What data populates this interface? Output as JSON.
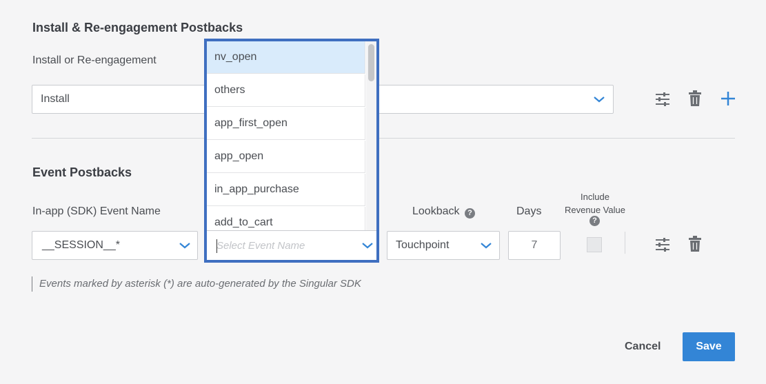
{
  "install_section": {
    "title": "Install & Re-engagement Postbacks",
    "field_label": "Install or Re-engagement",
    "selected_value": "Install"
  },
  "event_section": {
    "title": "Event Postbacks",
    "event_name_label": "In-app (SDK) Event Name",
    "event_name_value": "__SESSION__*",
    "lookback_label": "Lookback",
    "lookback_value": "Touchpoint",
    "days_label": "Days",
    "days_value": "7",
    "revenue_label_line1": "Include",
    "revenue_label_line2": "Revenue Value",
    "note": "Events marked by asterisk (*) are auto-generated by the Singular SDK"
  },
  "dropdown": {
    "items": [
      "nv_open",
      "others",
      "app_first_open",
      "app_open",
      "in_app_purchase",
      "add_to_cart"
    ],
    "active_index": 0,
    "placeholder": "Select Event Name"
  },
  "footer": {
    "cancel_label": "Cancel",
    "save_label": "Save"
  },
  "icons": {
    "help": "?"
  },
  "colors": {
    "accent": "#3385d6",
    "dropdown_border": "#3f6fc0",
    "active_item": "#d9ebfb"
  }
}
